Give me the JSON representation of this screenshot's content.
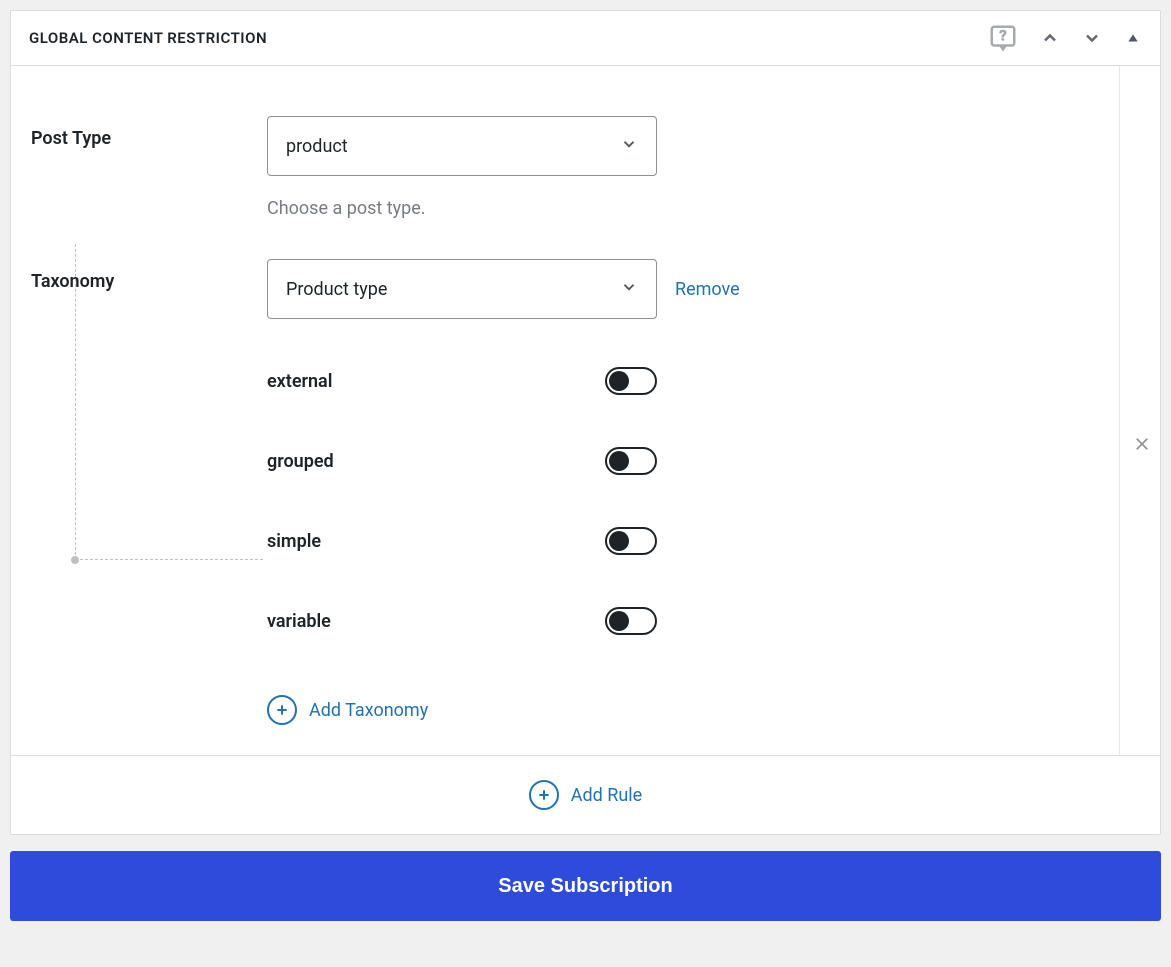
{
  "panel": {
    "title": "GLOBAL CONTENT RESTRICTION"
  },
  "postType": {
    "label": "Post Type",
    "value": "product",
    "help": "Choose a post type."
  },
  "taxonomy": {
    "label": "Taxonomy",
    "value": "Product type",
    "removeText": "Remove",
    "options": [
      {
        "label": "external",
        "enabled": false
      },
      {
        "label": "grouped",
        "enabled": false
      },
      {
        "label": "simple",
        "enabled": false
      },
      {
        "label": "variable",
        "enabled": false
      }
    ]
  },
  "addTaxonomy": "Add Taxonomy",
  "addRule": "Add Rule",
  "saveButton": "Save Subscription"
}
